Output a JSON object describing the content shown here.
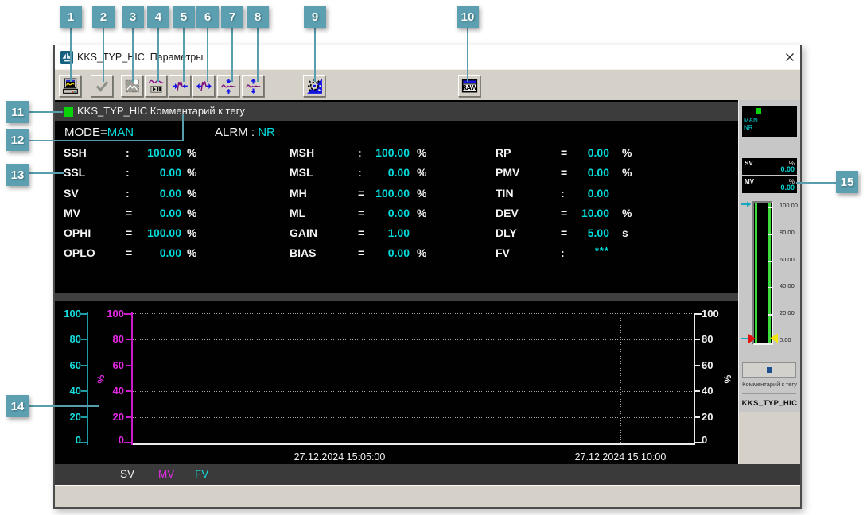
{
  "window": {
    "title": "KKS_TYP_HIC. Параметры"
  },
  "toolbar": {
    "buttons": [
      {
        "id": 1,
        "icon": "screen-copy-icon"
      },
      {
        "id": 2,
        "icon": "accept-check-icon"
      },
      {
        "id": 3,
        "icon": "snapshot-picture-icon"
      },
      {
        "id": 4,
        "icon": "trend-play-pause-icon"
      },
      {
        "id": 5,
        "icon": "compress-horizontal-icon"
      },
      {
        "id": 6,
        "icon": "expand-horizontal-icon"
      },
      {
        "id": 7,
        "icon": "compress-vertical-icon"
      },
      {
        "id": 8,
        "icon": "expand-vertical-icon"
      },
      {
        "id": 9,
        "icon": "alarm-lamp-icon"
      },
      {
        "id": 10,
        "icon": "raw-window-icon"
      }
    ]
  },
  "callouts": [
    "1",
    "2",
    "3",
    "4",
    "5",
    "6",
    "7",
    "8",
    "9",
    "10",
    "11",
    "12",
    "13",
    "14",
    "15"
  ],
  "param_panel": {
    "header": "KKS_TYP_HIC Комментарий к тегу",
    "mode": {
      "label": "MODE=",
      "value": "MAN"
    },
    "alarm": {
      "label": "ALRM",
      "sep": ":",
      "value": "NR"
    },
    "columns": [
      [
        {
          "name": "SSH",
          "sep": ":",
          "value": "100.00",
          "unit": "%"
        },
        {
          "name": "SSL",
          "sep": ":",
          "value": "0.00",
          "unit": "%"
        },
        {
          "name": "SV",
          "sep": ":",
          "value": "0.00",
          "unit": "%"
        },
        {
          "name": "MV",
          "sep": "=",
          "value": "0.00",
          "unit": "%"
        },
        {
          "name": "OPHI",
          "sep": "=",
          "value": "100.00",
          "unit": "%"
        },
        {
          "name": "OPLO",
          "sep": "=",
          "value": "0.00",
          "unit": "%"
        }
      ],
      [
        {
          "name": "MSH",
          "sep": ":",
          "value": "100.00",
          "unit": "%"
        },
        {
          "name": "MSL",
          "sep": ":",
          "value": "0.00",
          "unit": "%"
        },
        {
          "name": "MH",
          "sep": "=",
          "value": "100.00",
          "unit": "%"
        },
        {
          "name": "ML",
          "sep": "=",
          "value": "0.00",
          "unit": "%"
        },
        {
          "name": "GAIN",
          "sep": "=",
          "value": "1.00",
          "unit": ""
        },
        {
          "name": "BIAS",
          "sep": "=",
          "value": "0.00",
          "unit": "%"
        }
      ],
      [
        {
          "name": "RP",
          "sep": "=",
          "value": "0.00",
          "unit": "%"
        },
        {
          "name": "PMV",
          "sep": "=",
          "value": "0.00",
          "unit": "%"
        },
        {
          "name": "TIN",
          "sep": ":",
          "value": "0.00",
          "unit": ""
        },
        {
          "name": "DEV",
          "sep": "=",
          "value": "10.00",
          "unit": "%"
        },
        {
          "name": "DLY",
          "sep": "=",
          "value": "5.00",
          "unit": "s"
        },
        {
          "name": "FV",
          "sep": ":",
          "value": "***",
          "unit": ""
        }
      ]
    ]
  },
  "chart_data": {
    "type": "line",
    "title": "",
    "x_ticks": [
      "27.12.2024 15:05:00",
      "27.12.2024 15:10:00"
    ],
    "grid": true,
    "legend_position": "bottom",
    "y_axes": [
      {
        "id": "sv",
        "color": "#17dbdb",
        "unit": "%",
        "range": [
          0,
          100
        ],
        "ticks": [
          "100",
          "80",
          "60",
          "40",
          "20",
          "0"
        ]
      },
      {
        "id": "mv",
        "color": "#e32ae3",
        "unit": "%",
        "range": [
          0,
          100
        ],
        "ticks": [
          "100",
          "80",
          "60",
          "40",
          "20",
          "0"
        ]
      },
      {
        "id": "right",
        "color": "#f2f2f2",
        "unit": "%",
        "range": [
          0,
          100
        ],
        "ticks": [
          "100",
          "80",
          "60",
          "40",
          "20",
          "0"
        ]
      }
    ],
    "series": [
      {
        "name": "SV",
        "color": "#ffffff",
        "values": []
      },
      {
        "name": "MV",
        "color": "#e32ae3",
        "values": []
      },
      {
        "name": "FV",
        "color": "#17dbdb",
        "values": []
      }
    ]
  },
  "legend": {
    "items": [
      {
        "label": "SV",
        "color": "#f2f2f2"
      },
      {
        "label": "MV",
        "color": "#e32ae3"
      },
      {
        "label": "FV",
        "color": "#17dbdb"
      }
    ]
  },
  "faceplate": {
    "status": {
      "mode": "MAN",
      "alarm": "NR"
    },
    "sv": {
      "label": "SV",
      "unit": "%",
      "value": "0.00"
    },
    "mv": {
      "label": "MV",
      "unit": "%",
      "value": "0.00"
    },
    "gauge": {
      "scale": [
        "100.00",
        "80.00",
        "60.00",
        "40.00",
        "20.00",
        "0.00"
      ]
    },
    "comment": "Комментарий к тегу",
    "tag": "KKS_TYP_HIC"
  },
  "status_bar": {
    "text": ""
  }
}
